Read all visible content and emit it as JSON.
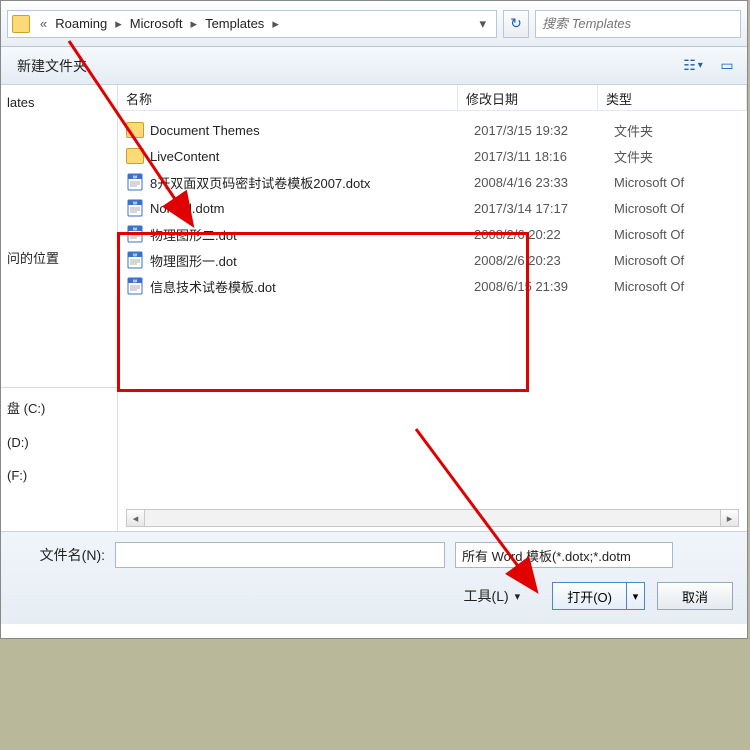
{
  "breadcrumb": {
    "segments": [
      "Roaming",
      "Microsoft",
      "Templates"
    ],
    "prefix": "«"
  },
  "search": {
    "placeholder": "搜索 Templates"
  },
  "toolbar": {
    "new_folder": "新建文件夹"
  },
  "nav": {
    "items": [
      "lates",
      "问的位置",
      "盘 (C:)",
      "(D:)",
      "(F:)"
    ]
  },
  "file_header": {
    "name": "名称",
    "date": "修改日期",
    "type": "类型"
  },
  "files": [
    {
      "icon": "folder",
      "name": "Document Themes",
      "date": "2017/3/15 19:32",
      "type": "文件夹"
    },
    {
      "icon": "folder",
      "name": "LiveContent",
      "date": "2017/3/11 18:16",
      "type": "文件夹"
    },
    {
      "icon": "doc",
      "name": "8开双面双页码密封试卷模板2007.dotx",
      "date": "2008/4/16 23:33",
      "type": "Microsoft Of"
    },
    {
      "icon": "doc",
      "name": "Normal.dotm",
      "date": "2017/3/14 17:17",
      "type": "Microsoft Of"
    },
    {
      "icon": "doc",
      "name": "物理图形二.dot",
      "date": "2008/2/6 20:22",
      "type": "Microsoft Of"
    },
    {
      "icon": "doc",
      "name": "物理图形一.dot",
      "date": "2008/2/6 20:23",
      "type": "Microsoft Of"
    },
    {
      "icon": "doc",
      "name": "信息技术试卷模板.dot",
      "date": "2008/6/15 21:39",
      "type": "Microsoft Of"
    }
  ],
  "bottom": {
    "filename_label": "文件名(N):",
    "filename_value": "",
    "filter_value": "所有 Word 模板(*.dotx;*.dotm",
    "tools_label": "工具(L)",
    "open_label": "打开(O)",
    "cancel_label": "取消"
  }
}
